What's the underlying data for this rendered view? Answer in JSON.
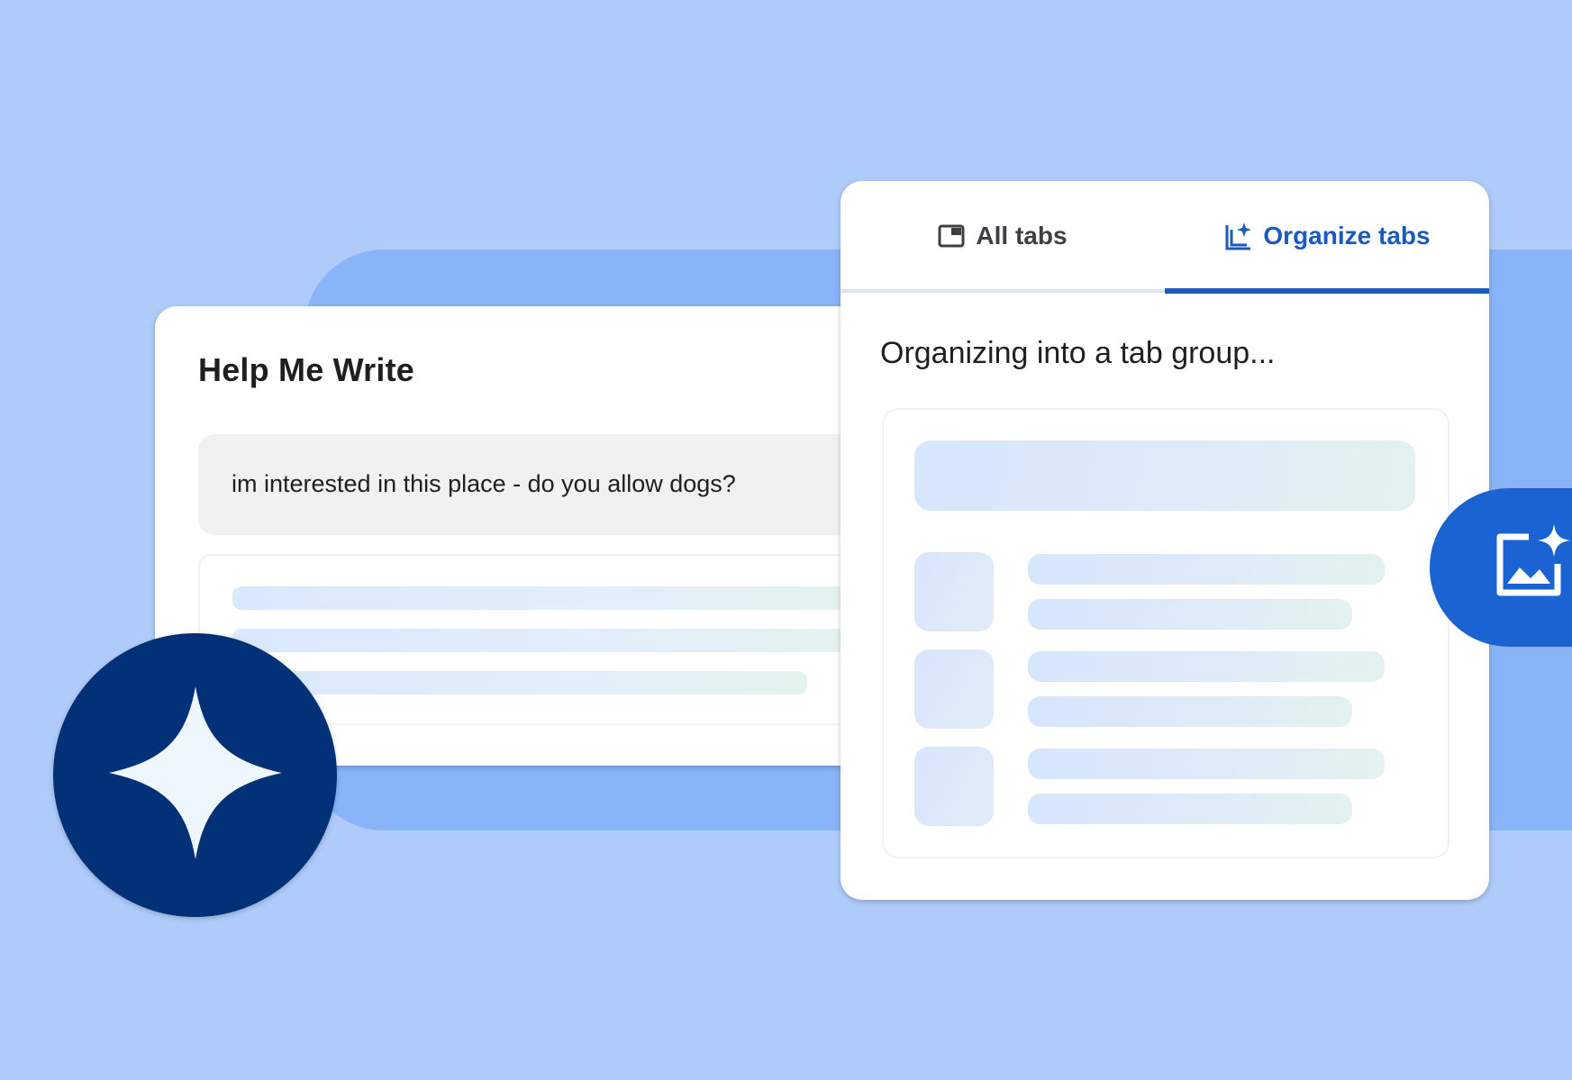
{
  "colors": {
    "background": "#aecbfa",
    "band": "#8ab4f8",
    "accent": "#1a5bbf",
    "star_badge": "#023177",
    "image_badge": "#1b63d2"
  },
  "help_me_write": {
    "title": "Help Me Write",
    "prompt": "im interested in this place - do you allow dogs?"
  },
  "tab_organizer": {
    "tabs": [
      {
        "label": "All tabs",
        "icon": "tab-window-icon",
        "selected": false
      },
      {
        "label": "Organize tabs",
        "icon": "organize-tabs-sparkle-icon",
        "selected": true
      }
    ],
    "status": "Organizing into a tab group..."
  },
  "badges": {
    "left": {
      "icon": "four-point-sparkle-icon"
    },
    "right": {
      "icon": "image-sparkle-icon"
    }
  }
}
